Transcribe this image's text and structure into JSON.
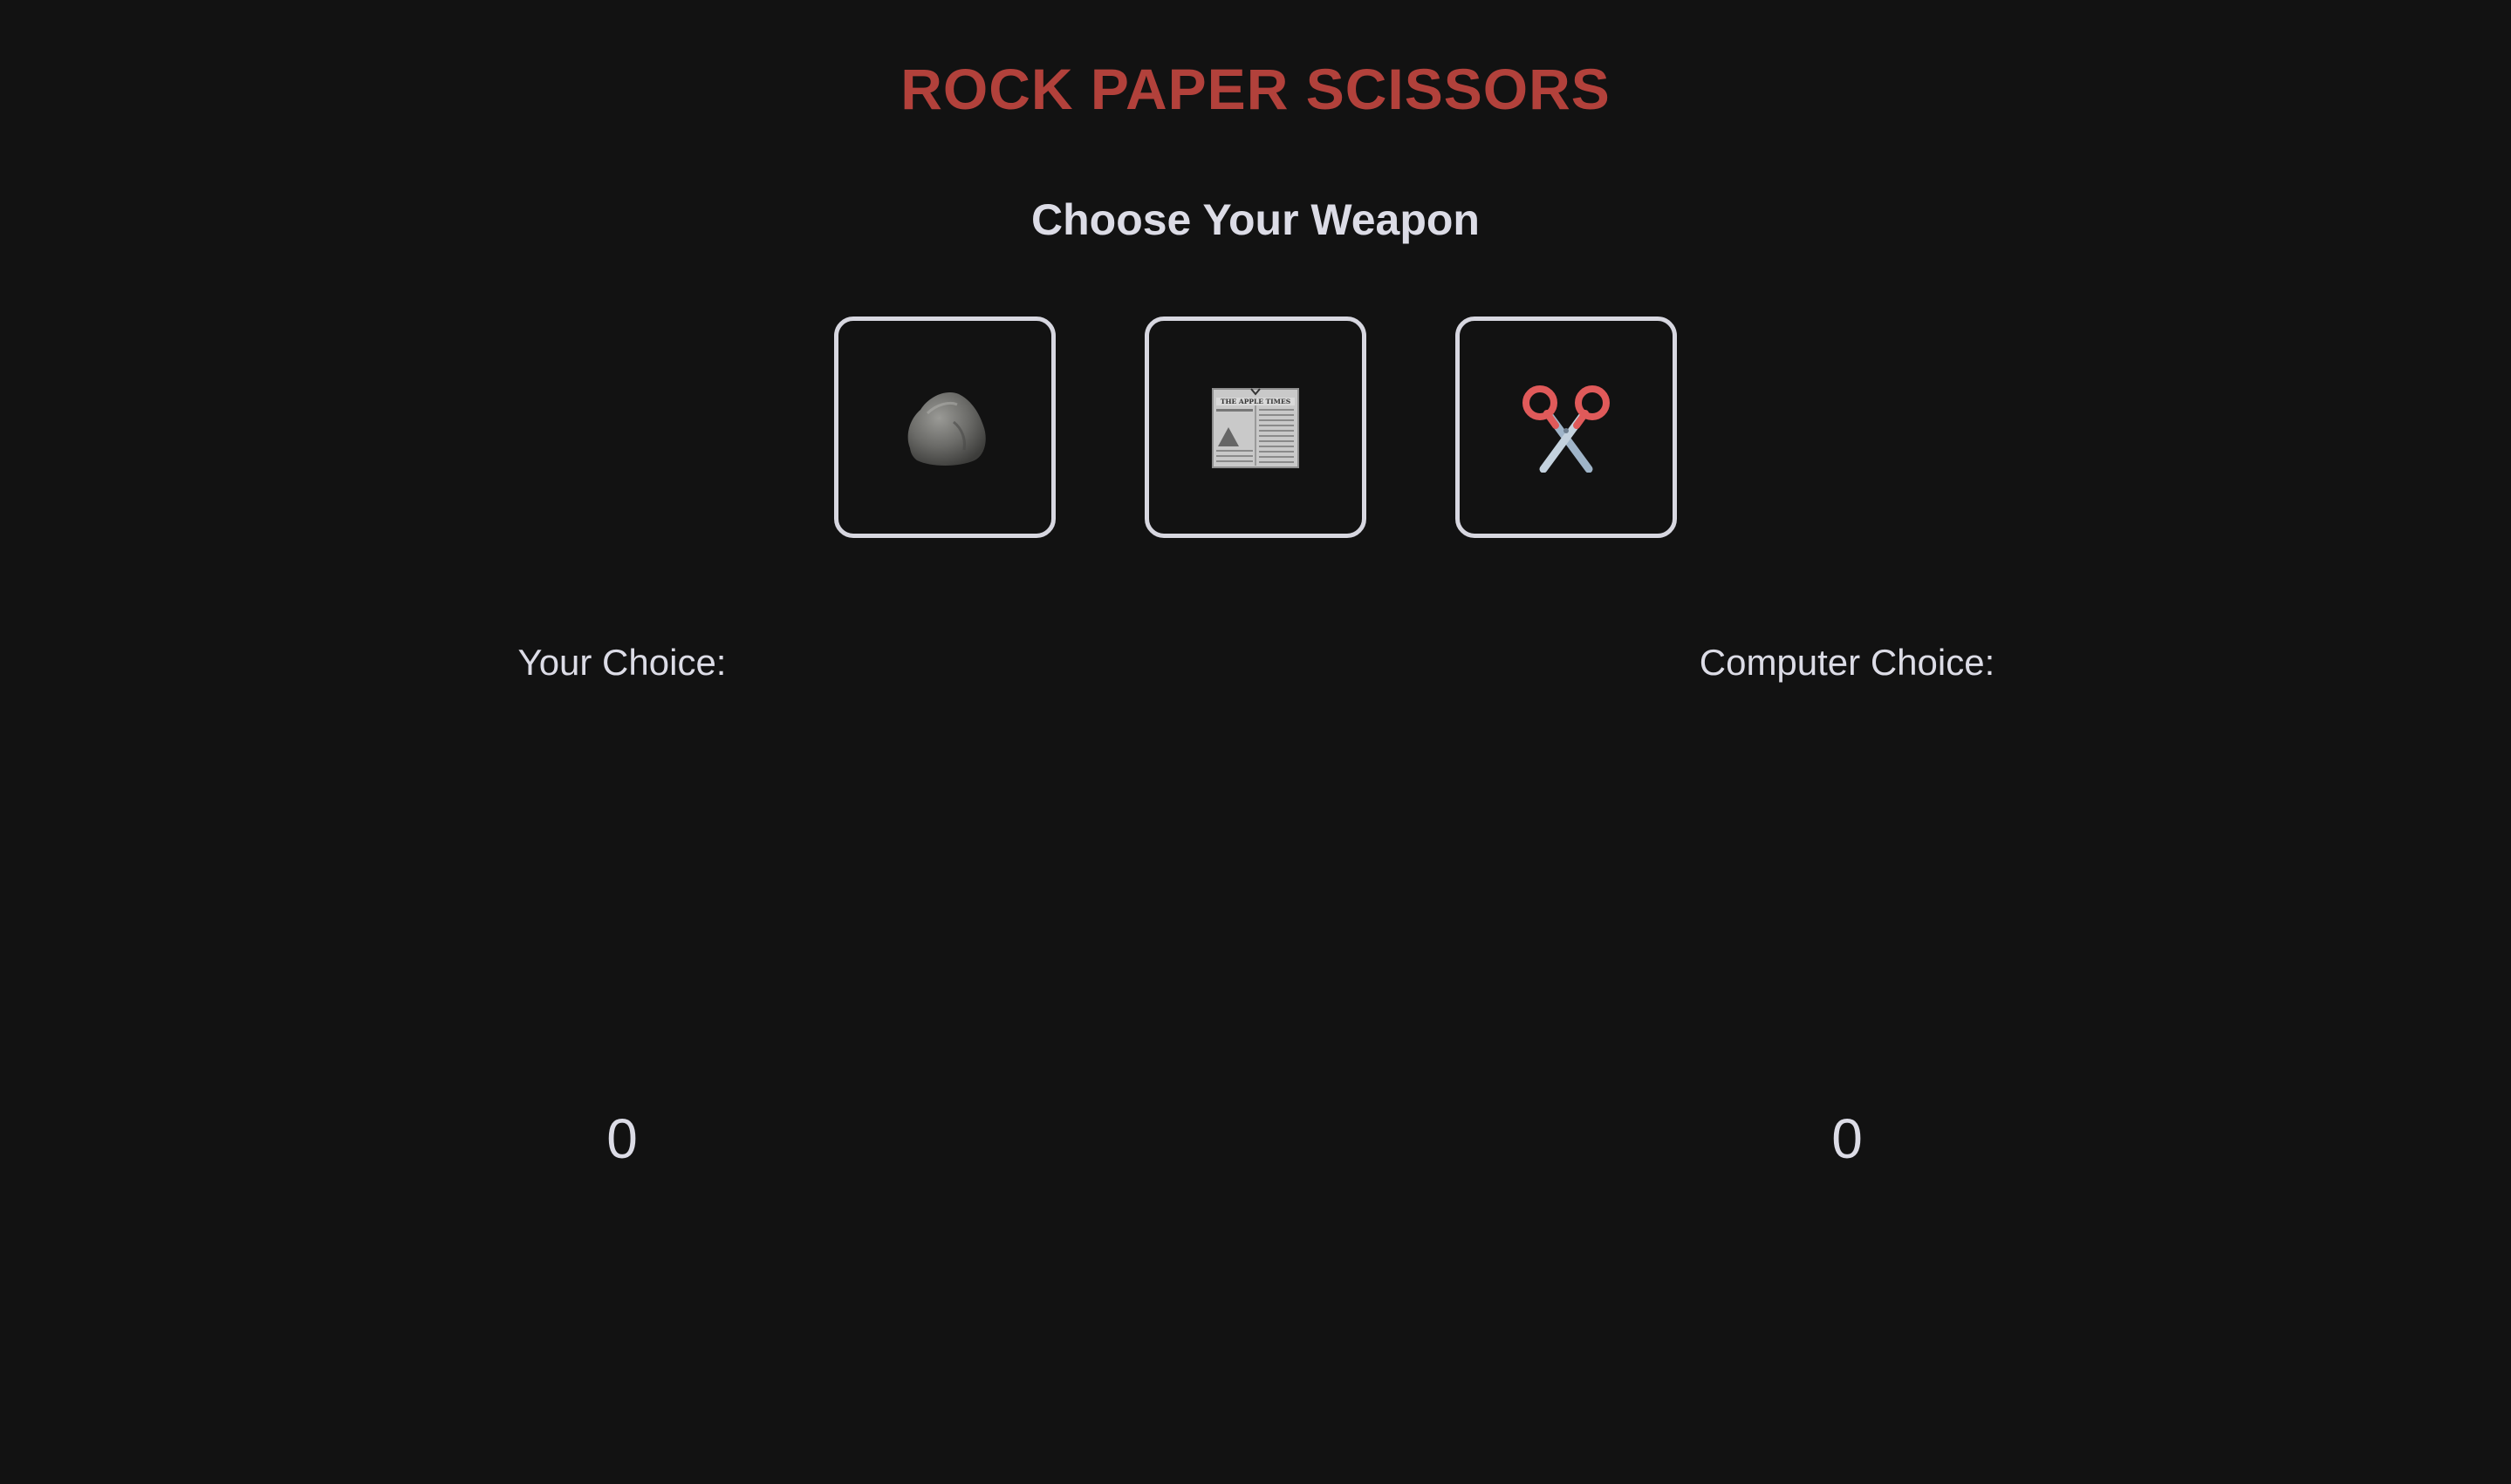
{
  "header": {
    "title": "ROCK PAPER SCISSORS",
    "subtitle": "Choose Your Weapon"
  },
  "weapons": [
    {
      "id": "rock",
      "icon": "rock-icon"
    },
    {
      "id": "paper",
      "icon": "newspaper-icon",
      "icon_text": "THE APPLE TIMES"
    },
    {
      "id": "scissors",
      "icon": "scissors-icon"
    }
  ],
  "player": {
    "label": "Your Choice:",
    "score": "0"
  },
  "computer": {
    "label": "Computer Choice:",
    "score": "0"
  },
  "colors": {
    "background": "#121212",
    "title": "#b2413b",
    "text": "#dcdce6",
    "border": "#d7d7e0"
  }
}
